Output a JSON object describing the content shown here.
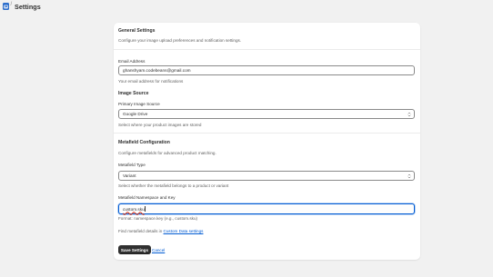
{
  "header": {
    "title": "Settings",
    "separator": "/",
    "app_icon": "app-logo-icon"
  },
  "general": {
    "heading": "General Settings",
    "description": "Configure your image upload preferences and notification settings.",
    "email_label": "Email Address",
    "email_value": "ghanshyam.codebeans@gmail.com",
    "email_help": "Your email address for notifications"
  },
  "image_source": {
    "heading": "Image Source",
    "select_label": "Primary Image Source",
    "select_value": "Google Drive",
    "help": "Select where your product images are stored"
  },
  "metafield": {
    "heading": "Metafield Configuration",
    "description": "Configure metafields for advanced product matching.",
    "type_label": "Metafield Type",
    "type_value": "Variant",
    "type_help": "Select whether the metafield belongs to a product or variant",
    "namespace_label": "Metafield Namespace and Key",
    "namespace_value": "custom.sku",
    "namespace_help": "Format: namespace.key (e.g., custom.sku)",
    "find_text": "Find metafield details in",
    "find_link": "Custom Data settings"
  },
  "actions": {
    "save_label": "Save Settings",
    "cancel_label": "Cancel"
  },
  "colors": {
    "background": "#f1f1f1",
    "card": "#ffffff",
    "primary_button": "#303030",
    "link": "#005bd3",
    "focus_ring": "#005bd3",
    "app_icon": "#2c6ecb"
  }
}
